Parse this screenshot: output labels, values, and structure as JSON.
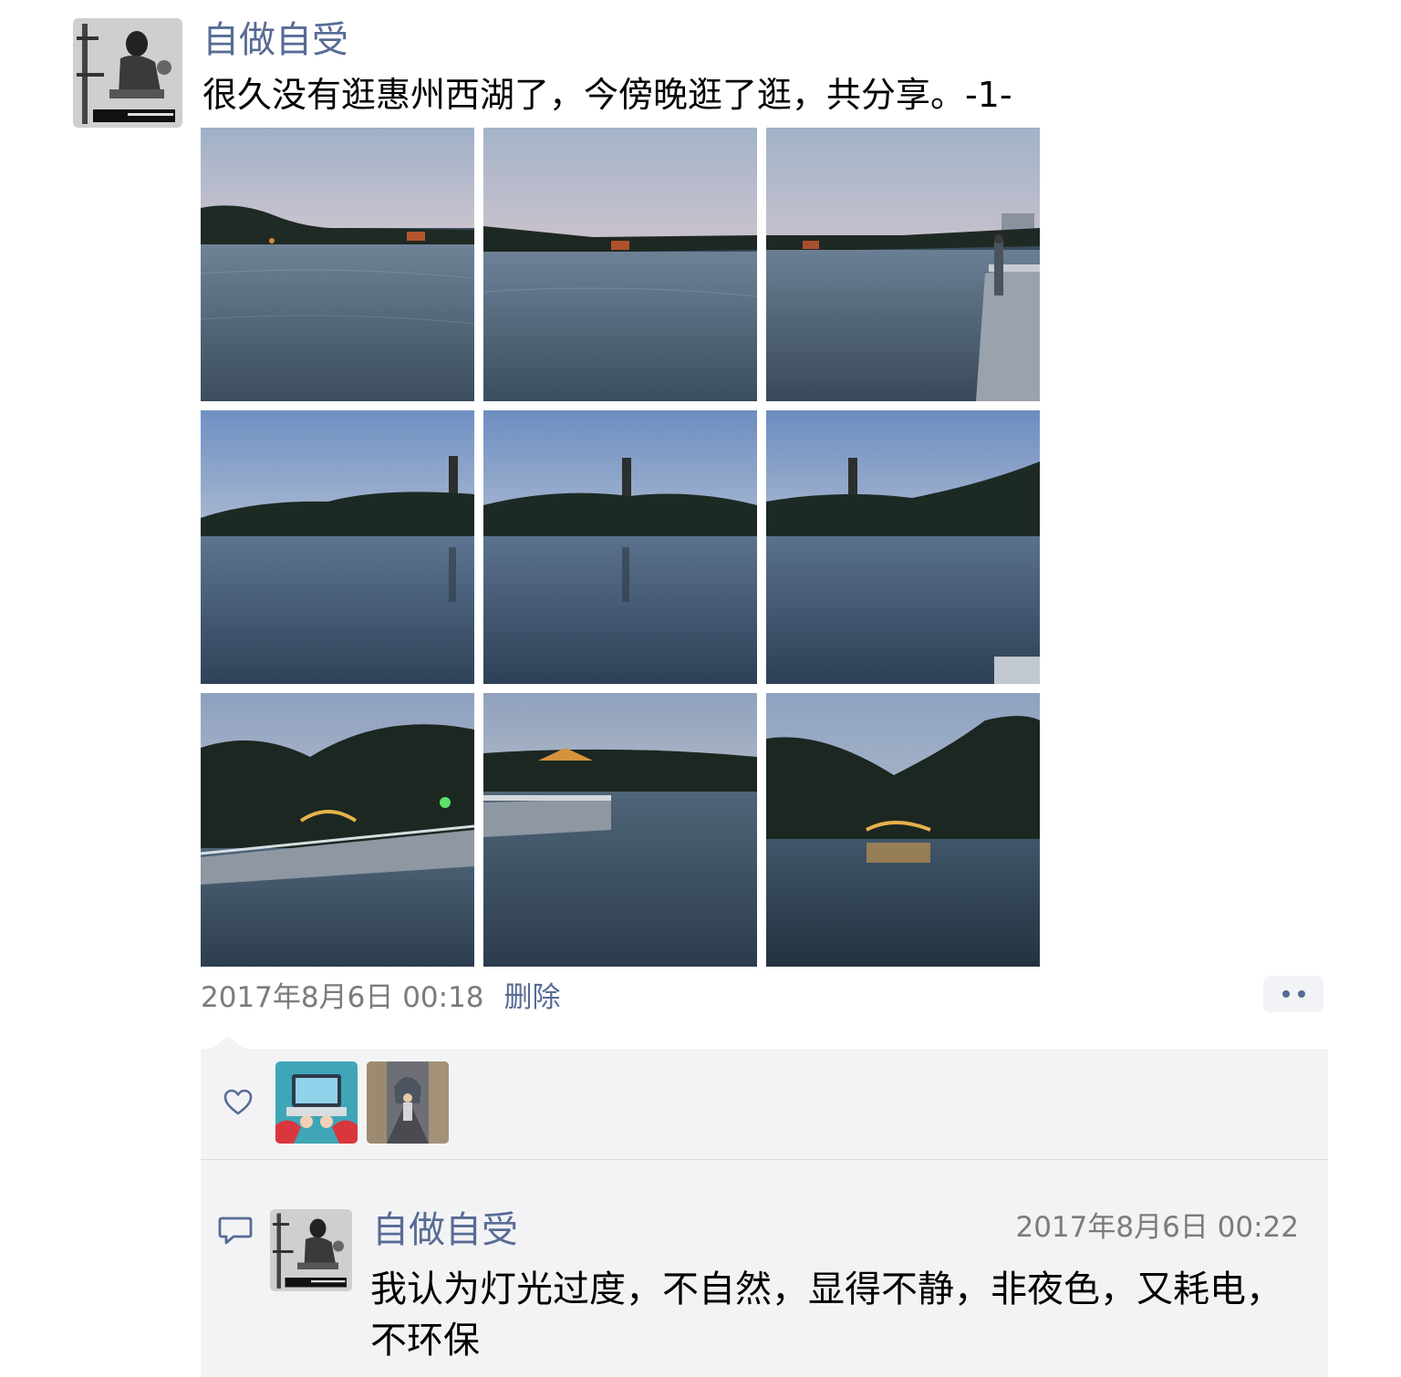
{
  "post": {
    "author_name": "自做自受",
    "text": "很久没有逛惠州西湖了，今傍晚逛了逛，共分享。-1-",
    "timestamp": "2017年8月6日 00:18",
    "delete_label": "删除",
    "avatar_icon": "author-avatar-photo",
    "photos": [
      "lake-dusk-photo",
      "lake-dusk-photo",
      "lake-railing-photo",
      "lake-pagoda-photo",
      "lake-pagoda-photo",
      "lake-pagoda-photo",
      "lake-bridge-photo",
      "lake-pavilion-photo",
      "lake-arch-bridge-photo"
    ]
  },
  "likes": {
    "icon": "heart-icon",
    "users": [
      "liker-avatar-laptop",
      "liker-avatar-street"
    ]
  },
  "comment": {
    "icon": "comment-icon",
    "author_name": "自做自受",
    "timestamp": "2017年8月6日 00:22",
    "text": "我认为灯光过度，不自然，显得不静，非夜色，又耗电，不环保"
  },
  "colors": {
    "link": "#576b95",
    "meta": "#7b7b7b",
    "panel": "#f3f3f5"
  }
}
